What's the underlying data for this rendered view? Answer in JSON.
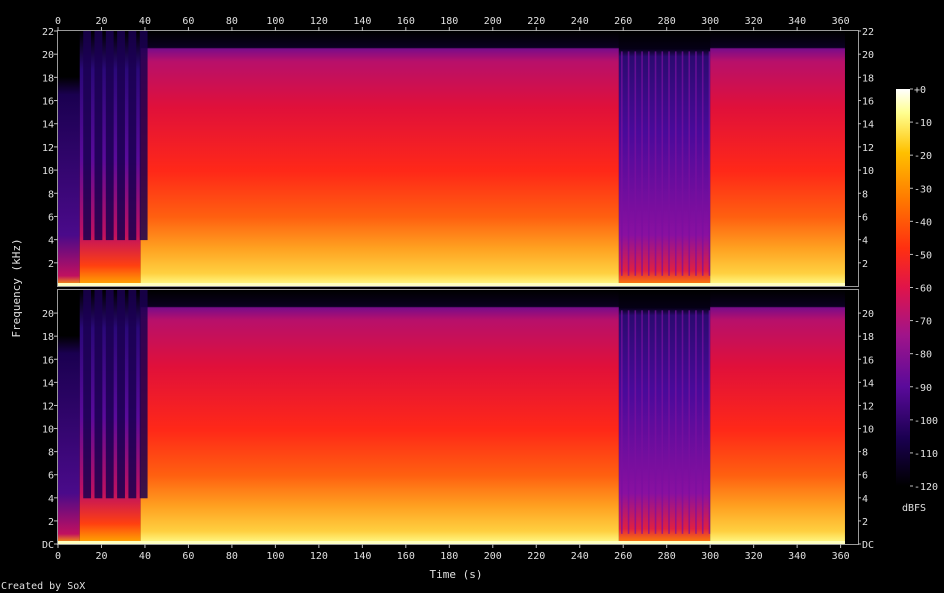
{
  "chart_data": {
    "type": "heatmap",
    "subtype": "spectrogram",
    "xlabel": "Time (s)",
    "ylabel": "Frequency (kHz)",
    "credit": "Created by SoX",
    "x_ticks": [
      0,
      20,
      40,
      60,
      80,
      100,
      120,
      140,
      160,
      180,
      200,
      220,
      240,
      260,
      280,
      300,
      320,
      340,
      360
    ],
    "xlim": [
      0,
      368
    ],
    "ylim": [
      0,
      22
    ],
    "y_ticks_top": [
      "2",
      "4",
      "6",
      "8",
      "10",
      "12",
      "14",
      "16",
      "18",
      "20",
      "22"
    ],
    "y_ticks_bottom": [
      "DC",
      "2",
      "4",
      "6",
      "8",
      "10",
      "12",
      "14",
      "16",
      "18",
      "20"
    ],
    "channels": 2,
    "colorbar": {
      "unit": "dBFS",
      "ticks": [
        "+0",
        "-10",
        "-20",
        "-30",
        "-40",
        "-50",
        "-60",
        "-70",
        "-80",
        "-90",
        "-100",
        "-110",
        "-120"
      ],
      "range": [
        -120,
        0
      ],
      "colors": [
        "#000000",
        "#1a0050",
        "#5a0a9a",
        "#a0148a",
        "#e0144a",
        "#ff3010",
        "#ff7800",
        "#ffc000",
        "#ffff90",
        "#ffffff"
      ]
    },
    "segments": [
      {
        "start": 0,
        "end": 10,
        "cutoff_khz": 18,
        "level": "quiet"
      },
      {
        "start": 10,
        "end": 38,
        "cutoff_khz": 20,
        "level": "sparse"
      },
      {
        "start": 38,
        "end": 258,
        "cutoff_khz": 20,
        "level": "loud"
      },
      {
        "start": 258,
        "end": 300,
        "cutoff_khz": 20,
        "level": "quiet"
      },
      {
        "start": 300,
        "end": 362,
        "cutoff_khz": 20,
        "level": "loud"
      }
    ]
  }
}
